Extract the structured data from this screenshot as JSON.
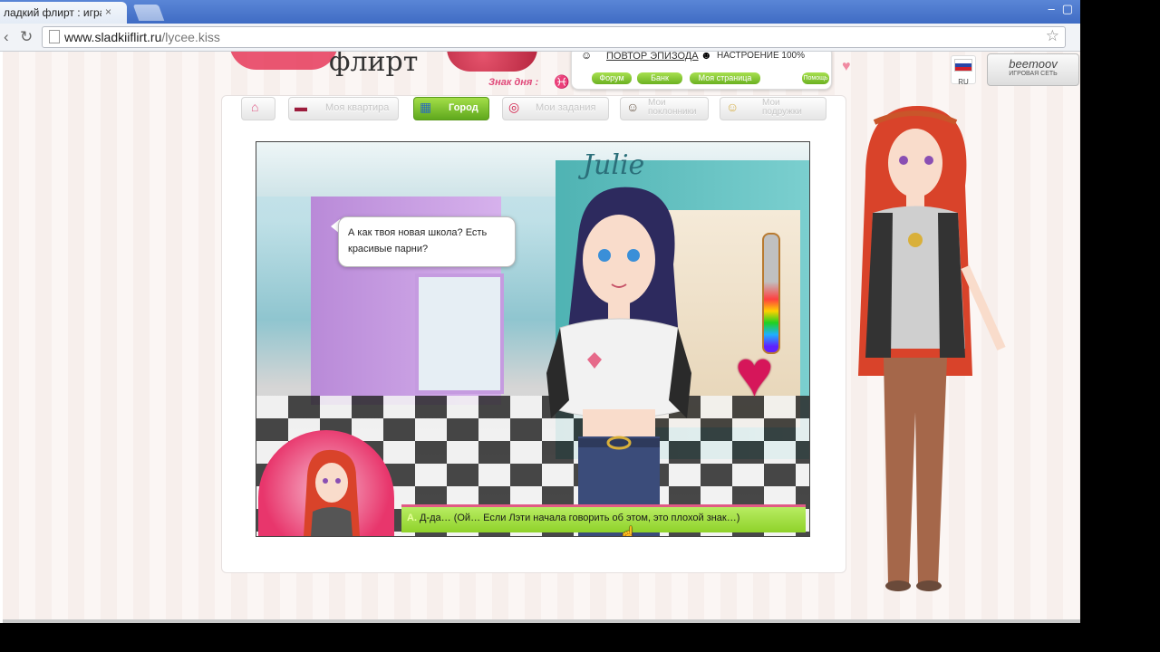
{
  "browser": {
    "tab_title": "ладкий флирт : игра о /",
    "tab_close": "×",
    "window_controls": [
      "–",
      "▢"
    ],
    "url_domain": "www.sladkiiflirt.ru",
    "url_path": "/lycee.kiss"
  },
  "header": {
    "logo_text": "флирт",
    "sign_of_day_label": "Знак дня :",
    "sign_of_day_symbol": "♓",
    "replay_episode": "ПОВТОР ЭПИЗОДА",
    "mood": "НАСТРОЕНИЕ 100%",
    "buttons": {
      "forum": "Форум",
      "bank": "Банк",
      "my_page": "Моя страница",
      "help": "Помощь"
    },
    "lang": "RU",
    "network_logo": "beemoov",
    "network_label": "ИГРОВАЯ СЕТЬ"
  },
  "nav": {
    "home": "",
    "apartment": "Моя квартира",
    "city": "Город",
    "tasks": "Мои задания",
    "admirers": [
      "Мои",
      "поклонники"
    ],
    "friends": [
      "Мои",
      "подружки"
    ]
  },
  "game": {
    "shop_sign": "Julie",
    "dialogue": "А как твоя новая школа? Есть красивые парни?",
    "choice_letter": "A.",
    "choice_text": "Д-да… (Ой… Если Лэти начала говорить об этом, это плохой знак…)"
  },
  "colors": {
    "accent_green": "#8fd22a",
    "accent_pink": "#e05a86",
    "tab_bar_blue": "#4a78cf"
  }
}
